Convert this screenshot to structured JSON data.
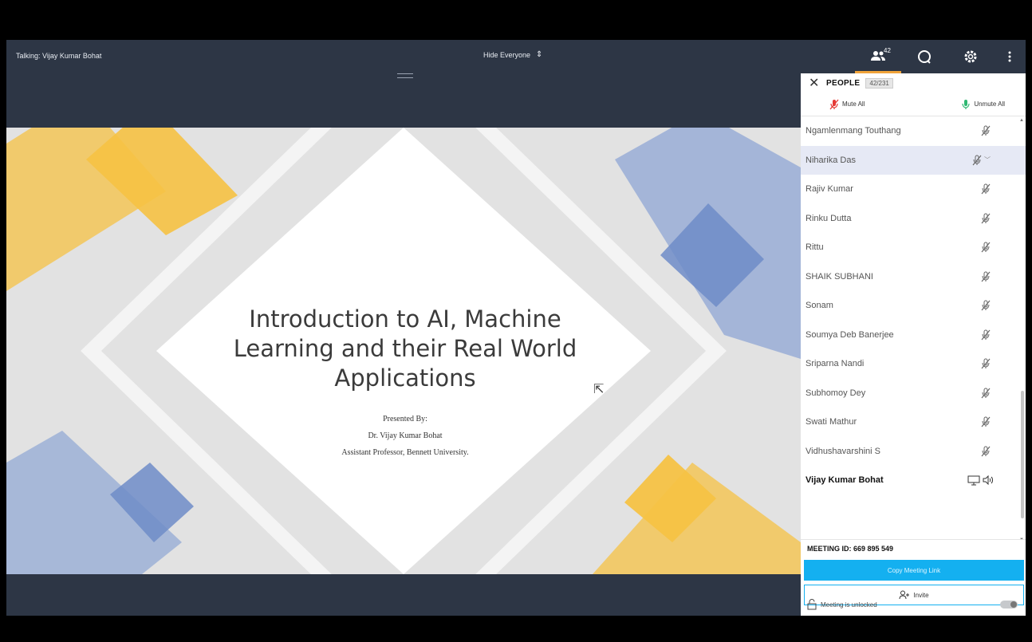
{
  "topbar": {
    "talking": "Talking: Vijay Kumar Bohat",
    "hide_everyone": "Hide Everyone",
    "people_count": "42",
    "icons": [
      "people-icon",
      "chat-icon",
      "gear-icon",
      "more-vertical-icon"
    ]
  },
  "slide": {
    "title_line1": "Introduction to AI, Machine",
    "title_line2": "Learning and their Real World",
    "title_line3": "Applications",
    "presented_by": "Presented By:",
    "presenter": "Dr. Vijay Kumar Bohat",
    "affiliation": "Assistant Professor, Bennett University."
  },
  "panel": {
    "title": "PEOPLE",
    "count": "42/231",
    "mute_all": "Mute All",
    "unmute_all": "Unmute All",
    "participants": [
      "Ngamlenmang Touthang",
      "Niharika Das",
      "Rajiv Kumar",
      "Rinku Dutta",
      "Rittu",
      "SHAIK SUBHANI",
      "Sonam",
      "Soumya Deb Banerjee",
      "Sriparna Nandi",
      "Subhomoy Dey",
      "Swati Mathur",
      "Vidhushavarshini S"
    ],
    "host": "Vijay Kumar Bohat",
    "meeting_id": "MEETING ID:  669 895 549",
    "copy_link": "Copy Meeting Link",
    "invite": "Invite",
    "lock_status": "Meeting is unlocked"
  },
  "colors": {
    "bar": "#2d3645",
    "accent": "#14b0f0",
    "people_underline": "#f0a33a",
    "mute_red": "#e53935",
    "unmute_green": "#2eb872",
    "slide_yellow": "#f6c244",
    "slide_blue": "#8fa6d4"
  }
}
